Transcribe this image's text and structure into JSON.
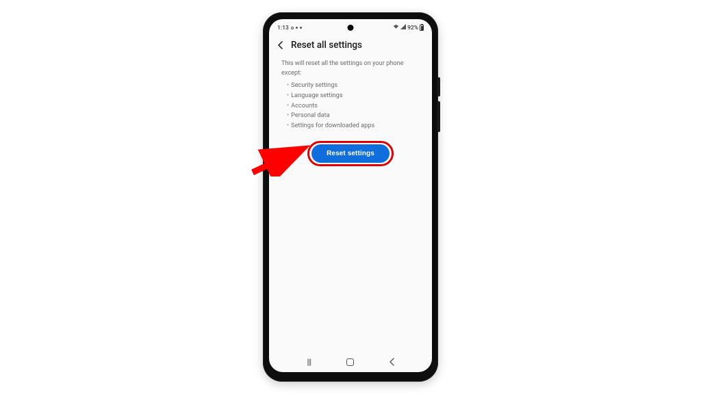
{
  "status_bar": {
    "time": "1:13",
    "battery_percent": "92%"
  },
  "header": {
    "title": "Reset all settings"
  },
  "body": {
    "intro": "This will reset all the settings on your phone except:",
    "bullets": [
      "Security settings",
      "Language settings",
      "Accounts",
      "Personal data",
      "Settings for downloaded apps"
    ]
  },
  "button": {
    "label": "Reset settings"
  },
  "annotation": {
    "highlight_color": "#e00000",
    "arrow_color": "#ff0000"
  }
}
